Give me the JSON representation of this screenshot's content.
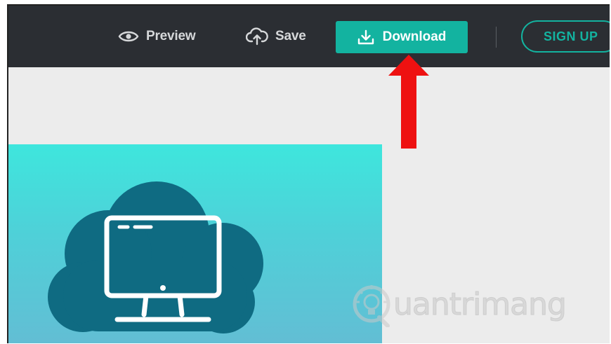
{
  "toolbar": {
    "preview_label": "Preview",
    "save_label": "Save",
    "download_label": "Download",
    "signup_label": "SIGN UP"
  },
  "icons": {
    "preview": "eye-icon",
    "save": "cloud-upload-icon",
    "download": "download-icon",
    "card_graphic": "cloud-monitor-icon",
    "watermark": "lightbulb-icon"
  },
  "watermark": {
    "text": "uantrimang"
  },
  "colors": {
    "topbar": "#2b2e33",
    "accent": "#13b3a0",
    "canvas_background": "#ececec",
    "card_top": "#3ee6dd",
    "card_bottom": "#63bdd4",
    "cloud": "#0f6b82",
    "arrow": "#ee1111"
  }
}
